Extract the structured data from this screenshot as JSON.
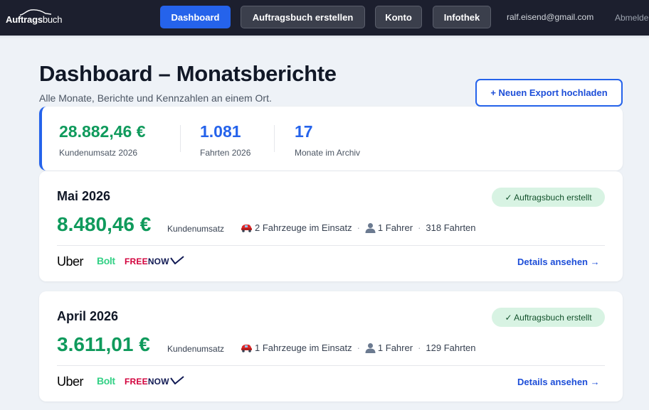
{
  "nav": {
    "logo_bold": "Auftrags",
    "logo_light": "buch",
    "dashboard_label": "Dashboard",
    "create_label": "Auftragsbuch erstellen",
    "konto_label": "Konto",
    "infothek_label": "Infothek",
    "email": "ralf.eisend@gmail.com",
    "logout_label": "Abmelden"
  },
  "header": {
    "title": "Dashboard – Monatsberichte",
    "subtitle": "Alle Monate, Berichte und Kennzahlen an einem Ort.",
    "upload_label": "+ Neuen Export hochladen"
  },
  "summary": {
    "revenue_value": "28.882,46 €",
    "revenue_label": "Kundenumsatz 2026",
    "trips_value": "1.081",
    "trips_label": "Fahrten 2026",
    "months_value": "17",
    "months_label": "Monate im Archiv"
  },
  "months": [
    {
      "title": "Mai 2026",
      "status": "✓ Auftragsbuch erstellt",
      "amount": "8.480,46 €",
      "amount_label": "Kundenumsatz",
      "vehicles": "2 Fahrzeuge im Einsatz",
      "drivers": "1 Fahrer",
      "trips": "318 Fahrten",
      "details_label": "Details ansehen →"
    },
    {
      "title": "April 2026",
      "status": "✓ Auftragsbuch erstellt",
      "amount": "3.611,01 €",
      "amount_label": "Kundenumsatz",
      "vehicles": "1 Fahrzeuge im Einsatz",
      "drivers": "1 Fahrer",
      "trips": "129 Fahrten",
      "details_label": "Details ansehen →"
    }
  ],
  "brands": {
    "uber": "Uber",
    "bolt": "Bolt",
    "freenow_free": "FREE",
    "freenow_now": "NOW"
  },
  "colors": {
    "accent": "#2563eb",
    "revenue_green": "#0f9a5c",
    "nav_bg": "#1c1f2e",
    "badge_bg": "#d8f3e3",
    "bolt_green": "#34d186",
    "freenow_red": "#d2003c",
    "freenow_navy": "#111a54"
  },
  "icons": {
    "car": "car-icon",
    "person": "person-icon",
    "logo_car": "car-outline-icon"
  }
}
